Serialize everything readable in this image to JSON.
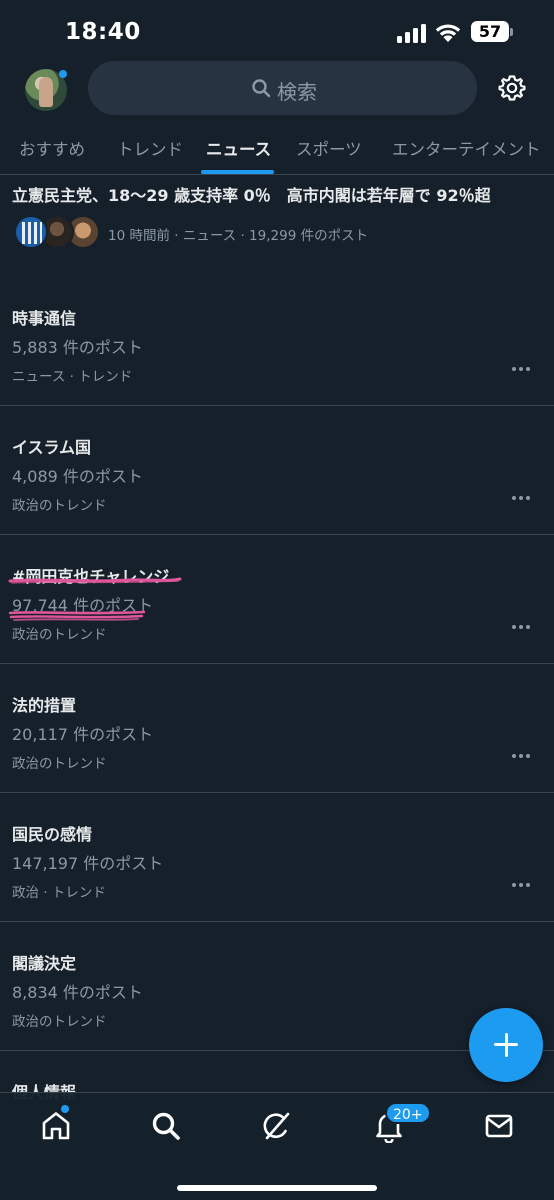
{
  "status_bar": {
    "time": "18:40",
    "battery": "57"
  },
  "search": {
    "placeholder": "検索"
  },
  "tabs": [
    {
      "label": "おすすめ",
      "active": false
    },
    {
      "label": "トレンド",
      "active": false
    },
    {
      "label": "ニュース",
      "active": true
    },
    {
      "label": "スポーツ",
      "active": false
    },
    {
      "label": "エンターテイメント",
      "active": false
    }
  ],
  "headline": {
    "title": "立憲民主党、18～29 歳支持率 0％　高市内閣は若年層で 92％超",
    "meta": "10 時間前 · ニュース · 19,299 件のポスト"
  },
  "trends": [
    {
      "name": "時事通信",
      "count": "5,883 件のポスト",
      "category": "ニュース · トレンド"
    },
    {
      "name": "イスラム国",
      "count": "4,089 件のポスト",
      "category": "政治のトレンド"
    },
    {
      "name": "#岡田克也チャレンジ",
      "count": "97,744 件のポスト",
      "category": "政治のトレンド"
    },
    {
      "name": "法的措置",
      "count": "20,117 件のポスト",
      "category": "政治のトレンド"
    },
    {
      "name": "国民の感情",
      "count": "147,197 件のポスト",
      "category": "政治 · トレンド"
    },
    {
      "name": "閣議決定",
      "count": "8,834 件のポスト",
      "category": "政治のトレンド"
    },
    {
      "name": "個人情報",
      "count": "",
      "category": ""
    }
  ],
  "bottom_nav": {
    "items": [
      "home-icon",
      "search-icon",
      "grok-icon",
      "notifications-icon",
      "messages-icon"
    ],
    "notification_badge": "20+"
  },
  "colors": {
    "background": "#15202b",
    "accent": "#1d9bf0",
    "divider": "#38444d",
    "muted": "#8b98a5",
    "annotation": "#e0569a"
  }
}
